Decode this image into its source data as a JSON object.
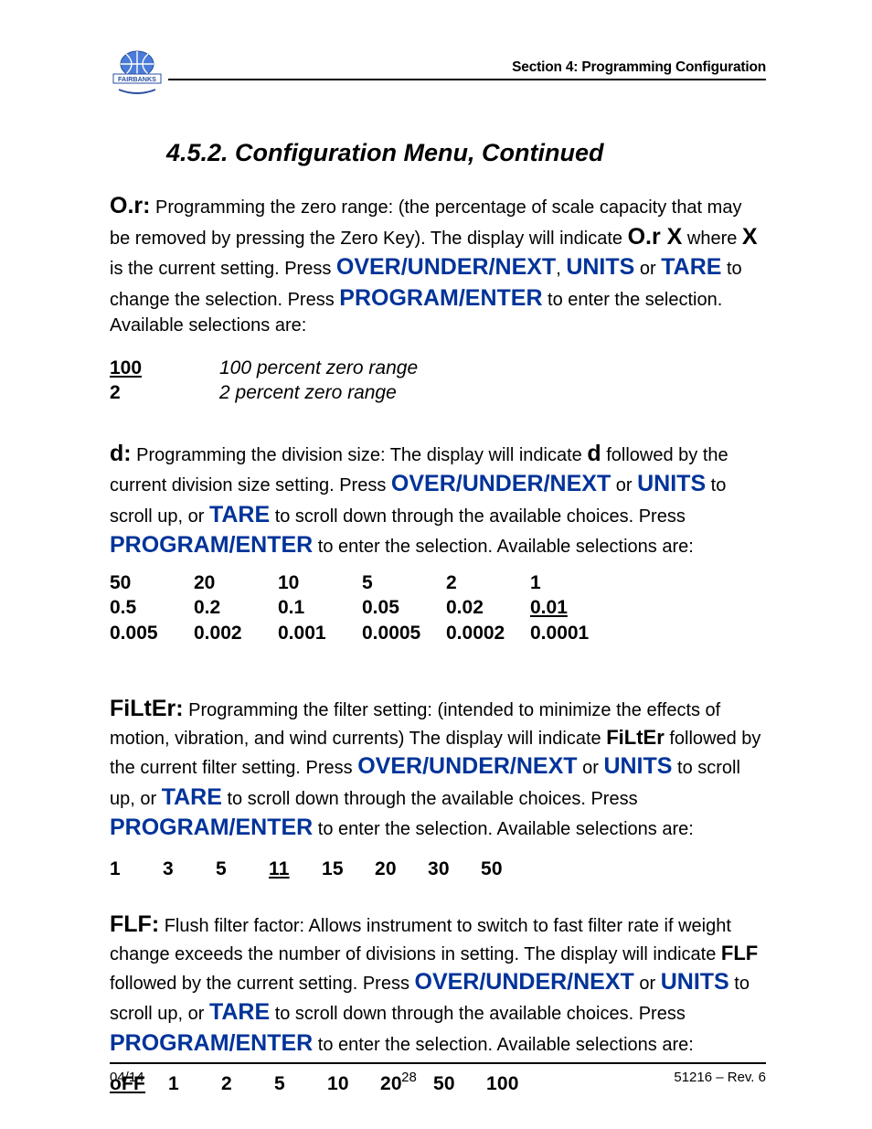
{
  "header": {
    "section_title": "Section 4: Programming Configuration",
    "logo_text": "FAIRBANKS"
  },
  "title": "4.5.2.  Configuration Menu, Continued",
  "or_section": {
    "lead": "O.r:",
    "t1": "  Programming the zero range: (the percentage of scale capacity that may be removed by pressing the Zero Key).  The display will indicate ",
    "orX": "O.r X",
    "t2": " where ",
    "X": "X",
    "t3": " is the current setting.  Press ",
    "k1": "OVER/UNDER/NEXT",
    "t4": ", ",
    "k2": "UNITS",
    "t5": " or ",
    "k3": "TARE",
    "t6": " to change the selection.  Press ",
    "k4": "PROGRAM/ENTER",
    "t7": " to enter the selection.  Available selections are:",
    "rows": [
      {
        "key": "100",
        "key_underline": true,
        "val": "100 percent zero range"
      },
      {
        "key": "2",
        "key_underline": false,
        "val": "2 percent zero range"
      }
    ]
  },
  "d_section": {
    "lead": "d:",
    "t1": "  Programming the division size:  The display will indicate ",
    "dword": "d",
    "t2": " followed by the current division size setting.  Press ",
    "k1": "OVER/UNDER/NEXT",
    "t3": " or ",
    "k2": "UNITS",
    "t4": " to scroll up, or ",
    "k3": "TARE",
    "t5": " to scroll down through the available choices.  Press ",
    "k4": "PROGRAM/ENTER",
    "t6": " to enter the selection.  Available selections are:",
    "grid": [
      [
        "50",
        "20",
        "10",
        "5",
        "2",
        "1"
      ],
      [
        "0.5",
        "0.2",
        "0.1",
        "0.05",
        "0.02",
        "0.01"
      ],
      [
        "0.005",
        "0.002",
        "0.001",
        "0.0005",
        "0.0002",
        "0.0001"
      ]
    ],
    "default_cell": {
      "r": 1,
      "c": 5
    }
  },
  "filter_section": {
    "lead": "FiLtEr:",
    "t1": "  Programming the filter setting:  (intended to minimize the effects of motion, vibration, and wind currents)  The display will indicate ",
    "fw": "FiLtEr",
    "t2": " followed by the current filter setting.  Press ",
    "k1": "OVER/UNDER/NEXT",
    "t3": " or ",
    "k2": "UNITS",
    "t4": " to scroll up, or ",
    "k3": "TARE",
    "t5": " to scroll down through the available choices.  Press ",
    "k4": "PROGRAM/ENTER",
    "t6": " to enter the selection.   Available selections are:",
    "values": [
      "1",
      "3",
      "5",
      "11",
      "15",
      "20",
      "30",
      "50"
    ],
    "default_index": 3
  },
  "flf_section": {
    "lead": "FLF:",
    "t1": "  Flush filter factor:  Allows instrument to switch to fast filter rate if weight change exceeds the number of divisions in setting.  The display will indicate ",
    "fw": "FLF",
    "t2": " followed by the current setting.  Press ",
    "k1": "OVER/UNDER/NEXT",
    "t3": " or ",
    "k2": "UNITS",
    "t4": " to scroll up, or ",
    "k3": "TARE",
    "t5": " to scroll down through the available choices.  Press ",
    "k4": "PROGRAM/ENTER",
    "t6": " to enter the selection.   Available selections are:",
    "values": [
      "oFF",
      "1",
      "2",
      "5",
      "10",
      "20",
      "50",
      "100"
    ],
    "default_index": 0
  },
  "footer": {
    "left": "04/14",
    "center": "28",
    "right": "51216 – Rev. 6"
  }
}
